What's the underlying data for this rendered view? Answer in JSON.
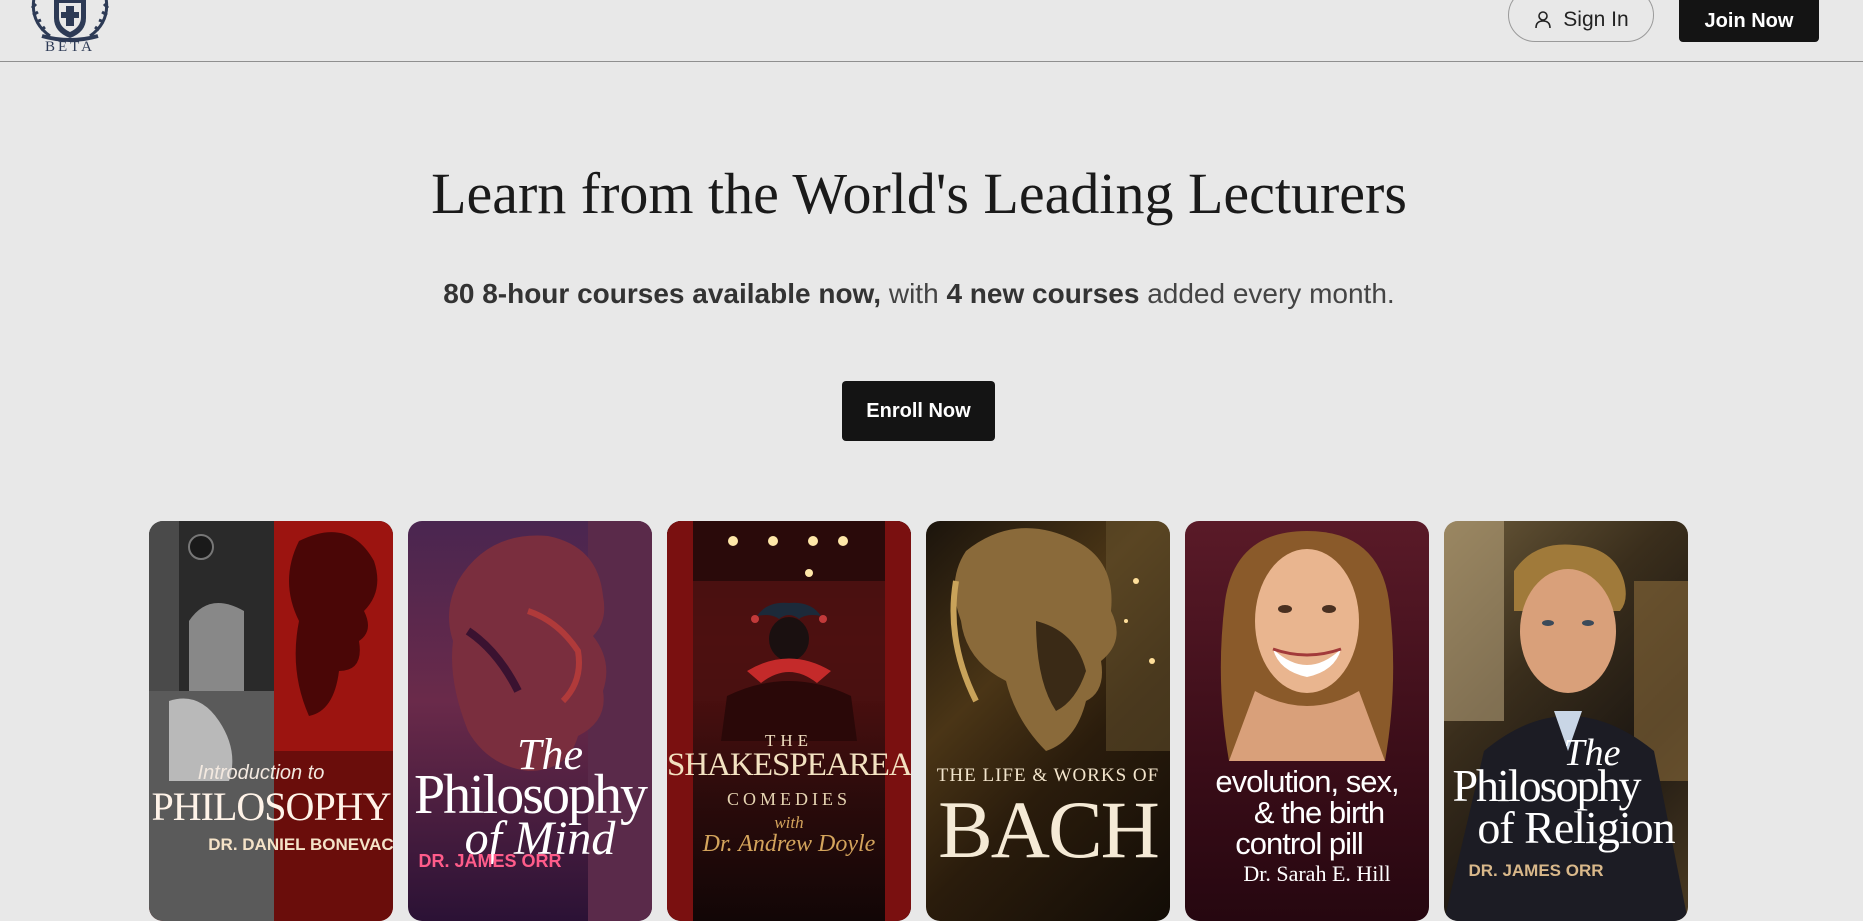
{
  "header": {
    "logo_text": "BETA",
    "signin_label": "Sign In",
    "join_label": "Join Now"
  },
  "hero": {
    "title": "Learn from the World's Leading Lecturers",
    "subtitle_part1": "80 8-hour courses available now,",
    "subtitle_part2": " with ",
    "subtitle_part3": "4 new courses",
    "subtitle_part4": " added every month.",
    "enroll_label": "Enroll Now"
  },
  "courses": [
    {
      "line1": "Introduction to",
      "line2": "PHILOSOPHY",
      "author": "DR. DANIEL BONEVAC"
    },
    {
      "line1": "The",
      "line2": "Philosophy",
      "line3": "of Mind",
      "author": "DR. JAMES ORR"
    },
    {
      "line1": "THE",
      "line2": "SHAKESPEAREAN",
      "line3": "COMEDIES",
      "line4": "with",
      "author": "Dr. Andrew Doyle"
    },
    {
      "line1": "THE LIFE & WORKS OF",
      "line2": "BACH"
    },
    {
      "line1": "evolution, sex,",
      "line2": "& the birth",
      "line3": "control pill",
      "author": "Dr. Sarah E. Hill"
    },
    {
      "line1": "The",
      "line2": "Philosophy",
      "line3": "of Religion",
      "author": "DR. JAMES ORR"
    }
  ]
}
